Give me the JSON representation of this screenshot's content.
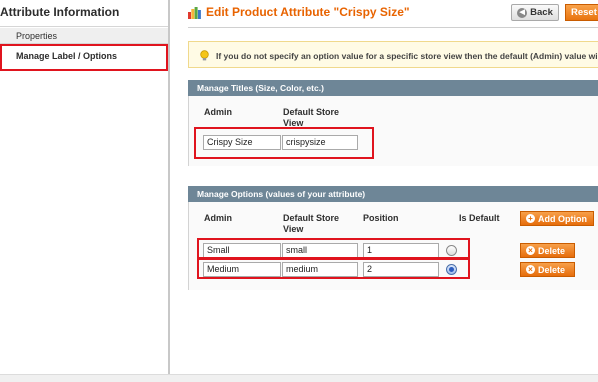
{
  "sidebar": {
    "title": "Attribute Information",
    "tabs": [
      {
        "label": "Properties"
      },
      {
        "label": "Manage Label / Options"
      }
    ]
  },
  "header": {
    "title": "Edit Product Attribute \"Crispy Size\"",
    "back_label": "Back",
    "reset_label": "Reset"
  },
  "notice": {
    "text": "If you do not specify an option value for a specific store view then the default (Admin) value will"
  },
  "titles_section": {
    "heading": "Manage Titles (Size, Color, etc.)",
    "col_admin": "Admin",
    "col_default": "Default Store View",
    "admin_value": "Crispy Size",
    "default_value": "crispysize"
  },
  "options_section": {
    "heading": "Manage Options (values of your attribute)",
    "col_admin": "Admin",
    "col_default": "Default Store View",
    "col_position": "Position",
    "col_is_default": "Is Default",
    "add_option_label": "Add Option",
    "delete_label": "Delete",
    "rows": [
      {
        "admin": "Small",
        "default": "small",
        "position": "1",
        "is_default": false
      },
      {
        "admin": "Medium",
        "default": "medium",
        "position": "2",
        "is_default": true
      }
    ]
  },
  "colors": {
    "accent": "#e86300",
    "section_header": "#6e8697",
    "highlight": "#e0141e"
  }
}
